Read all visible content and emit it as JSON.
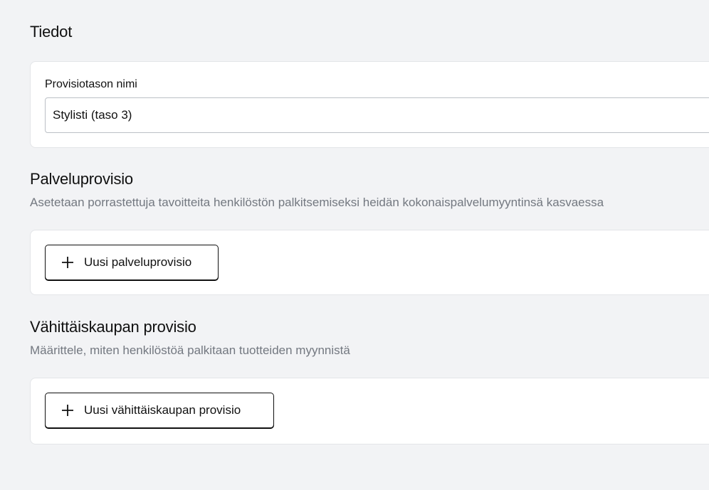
{
  "details": {
    "title": "Tiedot",
    "name_label": "Provisiotason nimi",
    "name_value": "Stylisti (taso 3)"
  },
  "service_commission": {
    "title": "Palveluprovisio",
    "description": "Asetetaan porrastettuja tavoitteita henkilöstön palkitsemiseksi heidän kokonaispalvelumyyntinsä kasvaessa",
    "add_button_label": "Uusi palveluprovisio",
    "add_button_icon": "plus-icon"
  },
  "retail_commission": {
    "title": "Vähittäiskaupan provisio",
    "description": "Määrittele, miten henkilöstöä palkitaan tuotteiden myynnistä",
    "add_button_label": "Uusi vähittäiskaupan provisio",
    "add_button_icon": "plus-icon"
  }
}
